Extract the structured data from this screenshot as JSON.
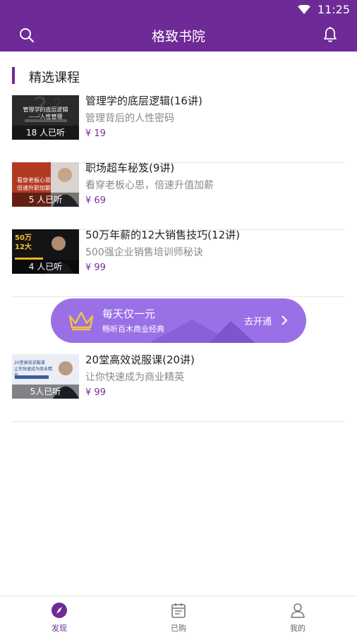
{
  "status_bar": {
    "time": "11:25"
  },
  "header": {
    "title": "格致书院"
  },
  "section": {
    "title": "精选课程"
  },
  "courses": [
    {
      "title": "管理学的底层逻辑(16讲)",
      "subtitle": "管理背后的人性密码",
      "price": "¥ 19",
      "listeners": "18 人已听",
      "thumb_text": [
        "管理学的底层逻辑",
        "——人性管理"
      ]
    },
    {
      "title": "职场超车秘笈(9讲)",
      "subtitle": "看穿老板心思，倍速升值加薪",
      "price": "¥ 69",
      "listeners": "5 人已听",
      "thumb_text": [
        "看穿老板心思",
        "倍速升职加薪"
      ]
    },
    {
      "title": "50万年薪的12大销售技巧(12讲)",
      "subtitle": "500强企业销售培训师秘诀",
      "price": "¥ 99",
      "listeners": "4 人已听",
      "thumb_text": [
        "50万",
        "12大"
      ]
    },
    {
      "title": "20堂高效说服课(20讲)",
      "subtitle": "让你快速成为商业精英",
      "price": "¥ 99",
      "listeners": "5人已听",
      "thumb_text": [
        "20堂高效说服课",
        "让你快速成为商业精英"
      ]
    }
  ],
  "promo": {
    "title": "每天仅一元",
    "subtitle": "畅听百木商业经典",
    "action": "去开通"
  },
  "tabs": [
    {
      "label": "发现",
      "icon": "compass-icon"
    },
    {
      "label": "已购",
      "icon": "calendar-icon"
    },
    {
      "label": "我的",
      "icon": "user-icon"
    }
  ],
  "colors": {
    "primary": "#6e2a96",
    "promo": "#9a70e6",
    "price": "#7b2aa0"
  }
}
